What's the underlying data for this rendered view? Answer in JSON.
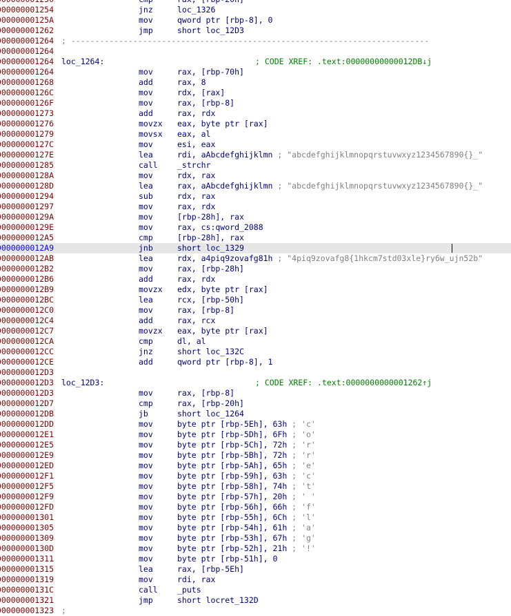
{
  "lines": [
    {
      "addr": "0000000001250",
      "mnem": "cmp",
      "ops": "rax, [rbp-20h]",
      "cmt": ""
    },
    {
      "addr": "0000000001254",
      "mnem": "jnz",
      "ops": "loc_1326",
      "cmt": ""
    },
    {
      "addr": "000000000125A",
      "mnem": "mov",
      "ops": "qword ptr [rbp-8], 0",
      "cmt": ""
    },
    {
      "addr": "0000000001262",
      "mnem": "jmp",
      "ops": "short loc_12D3",
      "cmt": ""
    },
    {
      "addr": "0000000001264",
      "sep": "; ---------------------------------------------------------------------------"
    },
    {
      "addr": "0000000001264"
    },
    {
      "addr": "0000000001264",
      "label": "loc_1264:",
      "label_cmt": "; CODE XREF: .text:00000000000012DB↓j"
    },
    {
      "addr": "0000000001264",
      "mnem": "mov",
      "ops": "rax, [rbp-70h]",
      "cmt": ""
    },
    {
      "addr": "0000000001268",
      "mnem": "add",
      "ops": "rax, 8",
      "cmt": ""
    },
    {
      "addr": "000000000126C",
      "mnem": "mov",
      "ops": "rdx, [rax]",
      "cmt": ""
    },
    {
      "addr": "000000000126F",
      "mnem": "mov",
      "ops": "rax, [rbp-8]",
      "cmt": ""
    },
    {
      "addr": "0000000001273",
      "mnem": "add",
      "ops": "rax, rdx",
      "cmt": ""
    },
    {
      "addr": "0000000001276",
      "mnem": "movzx",
      "ops": "eax, byte ptr [rax]",
      "cmt": ""
    },
    {
      "addr": "0000000001279",
      "mnem": "movsx",
      "ops": "eax, al",
      "cmt": ""
    },
    {
      "addr": "000000000127C",
      "mnem": "mov",
      "ops": "esi, eax",
      "cmt": ""
    },
    {
      "addr": "000000000127E",
      "mnem": "lea",
      "ops": "rdi, aAbcdefghijklmn",
      "cmt": " ; \"abcdefghijklmnopqrstuvwxyz1234567890{}_\""
    },
    {
      "addr": "0000000001285",
      "mnem": "call",
      "ops": "_strchr",
      "cmt": ""
    },
    {
      "addr": "000000000128A",
      "mnem": "mov",
      "ops": "rdx, rax",
      "cmt": ""
    },
    {
      "addr": "000000000128D",
      "mnem": "lea",
      "ops": "rax, aAbcdefghijklmn",
      "cmt": " ; \"abcdefghijklmnopqrstuvwxyz1234567890{}_\""
    },
    {
      "addr": "0000000001294",
      "mnem": "sub",
      "ops": "rdx, rax",
      "cmt": ""
    },
    {
      "addr": "0000000001297",
      "mnem": "mov",
      "ops": "rax, rdx",
      "cmt": ""
    },
    {
      "addr": "000000000129A",
      "mnem": "mov",
      "ops": "[rbp-28h], rax",
      "cmt": ""
    },
    {
      "addr": "000000000129E",
      "mnem": "mov",
      "ops": "rax, cs:qword_2088",
      "cmt": ""
    },
    {
      "addr": "00000000012A5",
      "mnem": "cmp",
      "ops": "[rbp-28h], rax",
      "cmt": ""
    },
    {
      "addr": "00000000012A9",
      "mnem": "jnb",
      "ops": "short loc_1329",
      "cmt": "",
      "highlight": true
    },
    {
      "addr": "00000000012AB",
      "mnem": "lea",
      "ops": "rdx, a4piq9zovafg81h",
      "cmt": " ; \"4piq9zovafg8{1hkcm7std03xle}ry6w_ujn52b\""
    },
    {
      "addr": "00000000012B2",
      "mnem": "mov",
      "ops": "rax, [rbp-28h]",
      "cmt": ""
    },
    {
      "addr": "00000000012B6",
      "mnem": "add",
      "ops": "rax, rdx",
      "cmt": ""
    },
    {
      "addr": "00000000012B9",
      "mnem": "movzx",
      "ops": "edx, byte ptr [rax]",
      "cmt": ""
    },
    {
      "addr": "00000000012BC",
      "mnem": "lea",
      "ops": "rcx, [rbp-50h]",
      "cmt": ""
    },
    {
      "addr": "00000000012C0",
      "mnem": "mov",
      "ops": "rax, [rbp-8]",
      "cmt": ""
    },
    {
      "addr": "00000000012C4",
      "mnem": "add",
      "ops": "rax, rcx",
      "cmt": ""
    },
    {
      "addr": "00000000012C7",
      "mnem": "movzx",
      "ops": "eax, byte ptr [rax]",
      "cmt": ""
    },
    {
      "addr": "00000000012CA",
      "mnem": "cmp",
      "ops": "dl, al",
      "cmt": ""
    },
    {
      "addr": "00000000012CC",
      "mnem": "jnz",
      "ops": "short loc_132C",
      "cmt": ""
    },
    {
      "addr": "00000000012CE",
      "mnem": "add",
      "ops": "qword ptr [rbp-8], 1",
      "cmt": ""
    },
    {
      "addr": "00000000012D3"
    },
    {
      "addr": "00000000012D3",
      "label": "loc_12D3:",
      "label_cmt": "; CODE XREF: .text:0000000000001262↑j"
    },
    {
      "addr": "00000000012D3",
      "mnem": "mov",
      "ops": "rax, [rbp-8]",
      "cmt": ""
    },
    {
      "addr": "00000000012D7",
      "mnem": "cmp",
      "ops": "rax, [rbp-20h]",
      "cmt": ""
    },
    {
      "addr": "00000000012DB",
      "mnem": "jb",
      "ops": "short loc_1264",
      "cmt": ""
    },
    {
      "addr": "00000000012DD",
      "mnem": "mov",
      "ops": "byte ptr [rbp-5Eh], 63h",
      "cmt": " ; 'c'"
    },
    {
      "addr": "00000000012E1",
      "mnem": "mov",
      "ops": "byte ptr [rbp-5Dh], 6Fh",
      "cmt": " ; 'o'"
    },
    {
      "addr": "00000000012E5",
      "mnem": "mov",
      "ops": "byte ptr [rbp-5Ch], 72h",
      "cmt": " ; 'r'"
    },
    {
      "addr": "00000000012E9",
      "mnem": "mov",
      "ops": "byte ptr [rbp-5Bh], 72h",
      "cmt": " ; 'r'"
    },
    {
      "addr": "00000000012ED",
      "mnem": "mov",
      "ops": "byte ptr [rbp-5Ah], 65h",
      "cmt": " ; 'e'"
    },
    {
      "addr": "00000000012F1",
      "mnem": "mov",
      "ops": "byte ptr [rbp-59h], 63h",
      "cmt": " ; 'c'"
    },
    {
      "addr": "00000000012F5",
      "mnem": "mov",
      "ops": "byte ptr [rbp-58h], 74h",
      "cmt": " ; 't'"
    },
    {
      "addr": "00000000012F9",
      "mnem": "mov",
      "ops": "byte ptr [rbp-57h], 20h",
      "cmt": " ; ' '"
    },
    {
      "addr": "00000000012FD",
      "mnem": "mov",
      "ops": "byte ptr [rbp-56h], 66h",
      "cmt": " ; 'f'"
    },
    {
      "addr": "0000000001301",
      "mnem": "mov",
      "ops": "byte ptr [rbp-55h], 6Ch",
      "cmt": " ; 'l'"
    },
    {
      "addr": "0000000001305",
      "mnem": "mov",
      "ops": "byte ptr [rbp-54h], 61h",
      "cmt": " ; 'a'"
    },
    {
      "addr": "0000000001309",
      "mnem": "mov",
      "ops": "byte ptr [rbp-53h], 67h",
      "cmt": " ; 'g'"
    },
    {
      "addr": "000000000130D",
      "mnem": "mov",
      "ops": "byte ptr [rbp-52h], 21h",
      "cmt": " ; '!'"
    },
    {
      "addr": "0000000001311",
      "mnem": "mov",
      "ops": "byte ptr [rbp-51h], 0",
      "cmt": ""
    },
    {
      "addr": "0000000001315",
      "mnem": "lea",
      "ops": "rax, [rbp-5Eh]",
      "cmt": ""
    },
    {
      "addr": "0000000001319",
      "mnem": "mov",
      "ops": "rdi, rax",
      "cmt": ""
    },
    {
      "addr": "000000000131C",
      "mnem": "call",
      "ops": "_puts",
      "cmt": ""
    },
    {
      "addr": "0000000001321",
      "mnem": "jmp",
      "ops": "short locret_132D",
      "cmt": ""
    },
    {
      "addr": "0000000001323",
      "sep": ";"
    }
  ],
  "colors": {
    "address": "#800000",
    "address_selected": "#0000ff",
    "instruction": "#000080",
    "label_comment": "#008000",
    "inline_comment": "#808080",
    "selected_row_bg": "#e6e6e6"
  }
}
